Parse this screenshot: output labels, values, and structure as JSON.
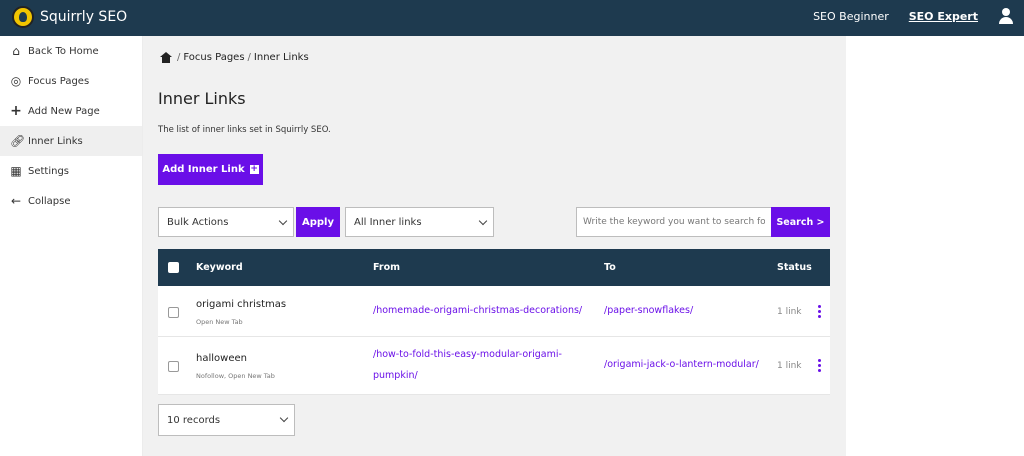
{
  "app": {
    "name": "Squirrly SEO"
  },
  "topnav": {
    "items": [
      "SEO Beginner",
      "SEO Expert"
    ],
    "active": "SEO Expert"
  },
  "sidebar": {
    "items": [
      {
        "label": "Back To Home",
        "icon": "home-icon"
      },
      {
        "label": "Focus Pages",
        "icon": "target-icon"
      },
      {
        "label": "Add New Page",
        "icon": "plus-icon"
      },
      {
        "label": "Inner Links",
        "icon": "link-icon",
        "active": true
      },
      {
        "label": "Settings",
        "icon": "sliders-icon"
      },
      {
        "label": "Collapse",
        "icon": "arrow-left-icon"
      }
    ]
  },
  "breadcrumb": {
    "items": [
      "Focus Pages",
      "Inner Links"
    ]
  },
  "page": {
    "title": "Inner Links",
    "description": "The list of inner links set in Squirrly SEO.",
    "add_button": "Add Inner Link"
  },
  "filters": {
    "bulk_actions": "Bulk Actions",
    "apply": "Apply",
    "link_filter": "All Inner links",
    "search_placeholder": "Write the keyword you want to search for",
    "search_button": "Search >"
  },
  "table": {
    "headers": {
      "keyword": "Keyword",
      "from": "From",
      "to": "To",
      "status": "Status"
    },
    "rows": [
      {
        "keyword": "origami christmas",
        "options": "Open New Tab",
        "from": "/homemade-origami-christmas-decorations/",
        "to": "/paper-snowflakes/",
        "status": "1 link"
      },
      {
        "keyword": "halloween",
        "options": "Nofollow, Open New Tab",
        "from_line1": "/how-to-fold-this-easy-modular-origami-",
        "from_line2": "pumpkin/",
        "to": "/origami-jack-o-lantern-modular/",
        "status": "1 link"
      }
    ]
  },
  "pagination": {
    "records": "10 records"
  },
  "colors": {
    "accent": "#6a0fe8",
    "header": "#1e3a4f",
    "background": "#f1f1f1"
  }
}
